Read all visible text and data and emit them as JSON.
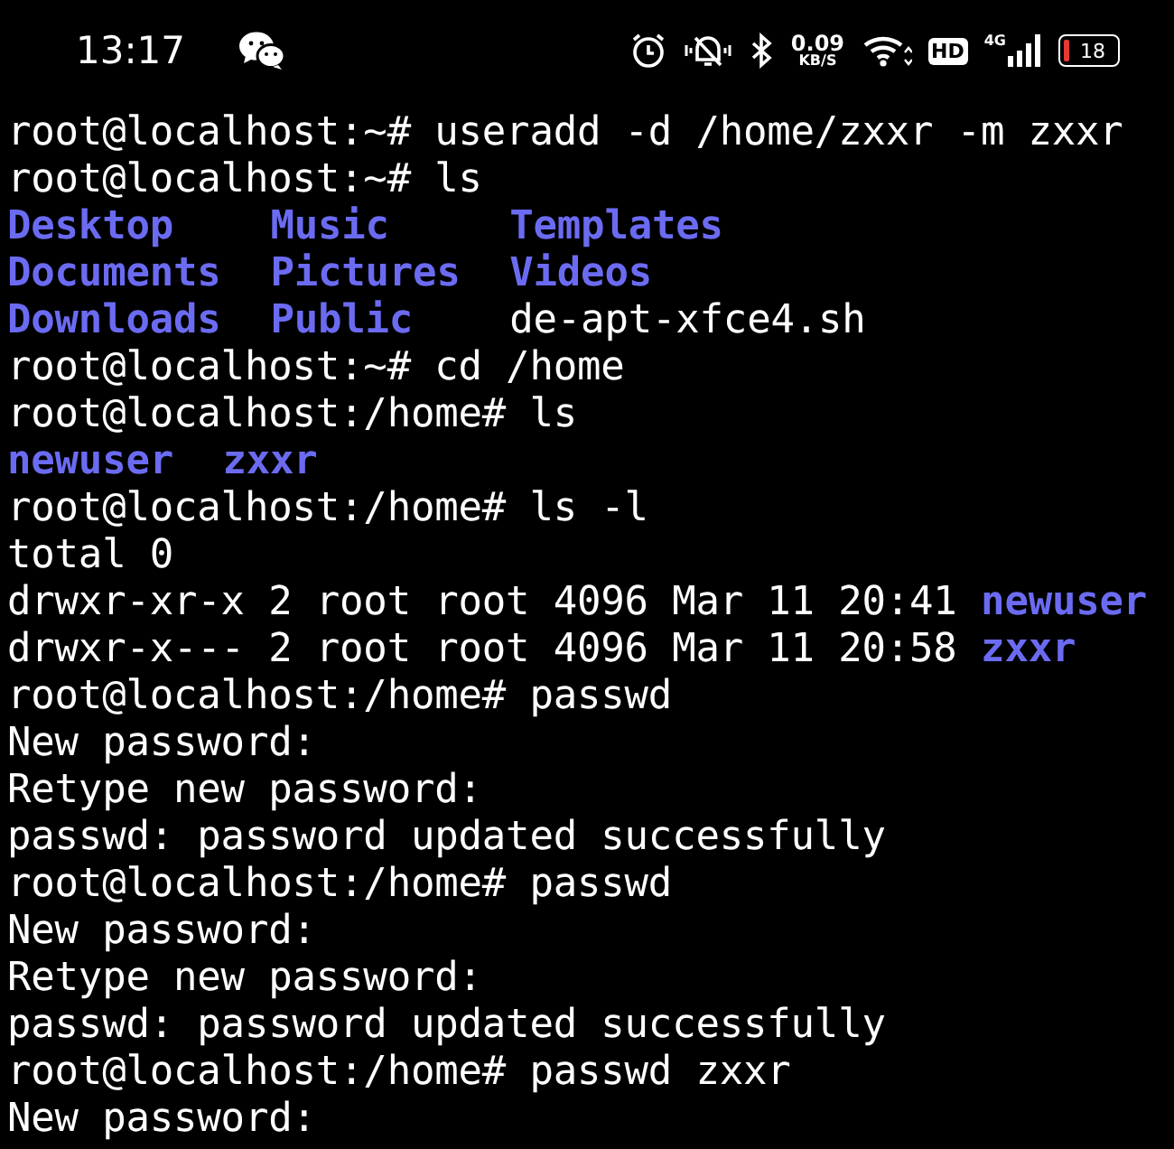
{
  "status_bar": {
    "time": "13:17",
    "net_speed": "0.09",
    "net_unit": "KB/S",
    "hd_badge": "HD",
    "network_type": "4G",
    "battery": "18"
  },
  "terminal": {
    "lines": [
      {
        "kind": "text",
        "text": "root@localhost:~# useradd -d /home/zxxr -m zxxr"
      },
      {
        "kind": "text",
        "text": "root@localhost:~# ls"
      },
      {
        "kind": "listing",
        "items": [
          {
            "name": "Desktop",
            "kind": "dir"
          },
          {
            "name": "Music",
            "kind": "dir"
          },
          {
            "name": "Templates",
            "kind": "dir"
          }
        ]
      },
      {
        "kind": "listing",
        "items": [
          {
            "name": "Documents",
            "kind": "dir"
          },
          {
            "name": "Pictures",
            "kind": "dir"
          },
          {
            "name": "Videos",
            "kind": "dir"
          }
        ]
      },
      {
        "kind": "listing",
        "items": [
          {
            "name": "Downloads",
            "kind": "dir"
          },
          {
            "name": "Public",
            "kind": "dir"
          },
          {
            "name": "de-apt-xfce4.sh",
            "kind": "file"
          }
        ]
      },
      {
        "kind": "text",
        "text": "root@localhost:~# cd /home"
      },
      {
        "kind": "text",
        "text": "root@localhost:/home# ls"
      },
      {
        "kind": "listing",
        "items": [
          {
            "name": "newuser",
            "kind": "dir"
          },
          {
            "name": "zxxr",
            "kind": "dir"
          }
        ]
      },
      {
        "kind": "text",
        "text": "root@localhost:/home# ls -l"
      },
      {
        "kind": "text",
        "text": "total 0"
      },
      {
        "kind": "long",
        "text": "drwxr-xr-x 2 root root 4096 Mar 11 20:41",
        "item": {
          "name": "newuser",
          "kind": "dir"
        }
      },
      {
        "kind": "long",
        "text": "drwxr-x--- 2 root root 4096 Mar 11 20:58",
        "item": {
          "name": "zxxr",
          "kind": "dir"
        }
      },
      {
        "kind": "text",
        "text": "root@localhost:/home# passwd"
      },
      {
        "kind": "text",
        "text": "New password:"
      },
      {
        "kind": "text",
        "text": "Retype new password:"
      },
      {
        "kind": "text",
        "text": "passwd: password updated successfully"
      },
      {
        "kind": "text",
        "text": "root@localhost:/home# passwd"
      },
      {
        "kind": "text",
        "text": "New password:"
      },
      {
        "kind": "text",
        "text": "Retype new password:"
      },
      {
        "kind": "text",
        "text": "passwd: password updated successfully"
      },
      {
        "kind": "text",
        "text": "root@localhost:/home# passwd zxxr"
      },
      {
        "kind": "text",
        "text": "New password:"
      }
    ]
  }
}
